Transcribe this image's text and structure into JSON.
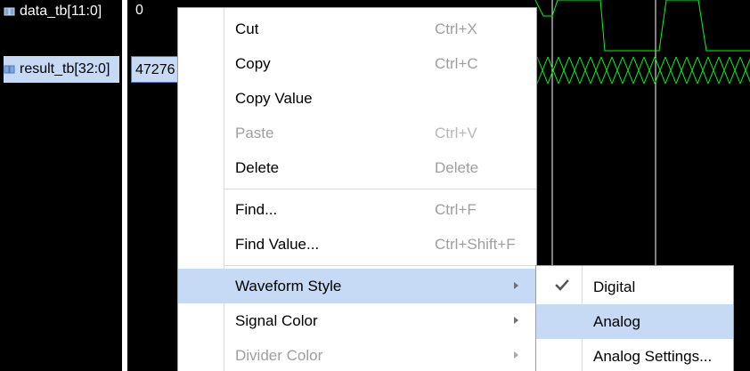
{
  "signals": [
    {
      "name": "data_tb[11:0]",
      "value": "0",
      "icon": "bus-signal-icon",
      "selected": false
    },
    {
      "name": "result_tb[32:0]",
      "value": "47276",
      "icon": "bus-signal-icon",
      "selected": true
    }
  ],
  "context_menu": {
    "items": [
      {
        "label": "Cut",
        "shortcut": "Ctrl+X",
        "enabled": true
      },
      {
        "label": "Copy",
        "shortcut": "Ctrl+C",
        "enabled": true
      },
      {
        "label": "Copy Value",
        "shortcut": "",
        "enabled": true
      },
      {
        "label": "Paste",
        "shortcut": "Ctrl+V",
        "enabled": false
      },
      {
        "label": "Delete",
        "shortcut": "Delete",
        "enabled": true
      },
      {
        "label": "Find...",
        "shortcut": "Ctrl+F",
        "enabled": true
      },
      {
        "label": "Find Value...",
        "shortcut": "Ctrl+Shift+F",
        "enabled": true
      },
      {
        "label": "Waveform Style",
        "submenu": true,
        "enabled": true,
        "highlighted": true
      },
      {
        "label": "Signal Color",
        "submenu": true,
        "enabled": true
      },
      {
        "label": "Divider Color",
        "submenu": true,
        "enabled": false
      }
    ]
  },
  "waveform_style_submenu": {
    "items": [
      {
        "label": "Digital",
        "checked": true,
        "icon": "checkmark-icon"
      },
      {
        "label": "Analog",
        "checked": false,
        "highlighted": true
      },
      {
        "label": "Analog Settings...",
        "checked": false
      }
    ]
  },
  "colors": {
    "background": "#000000",
    "waveform": "#00ff00",
    "cursor_line": "#ffffff",
    "selection": "#c6d9f5",
    "menu_disabled_text": "#9e9e9e"
  }
}
